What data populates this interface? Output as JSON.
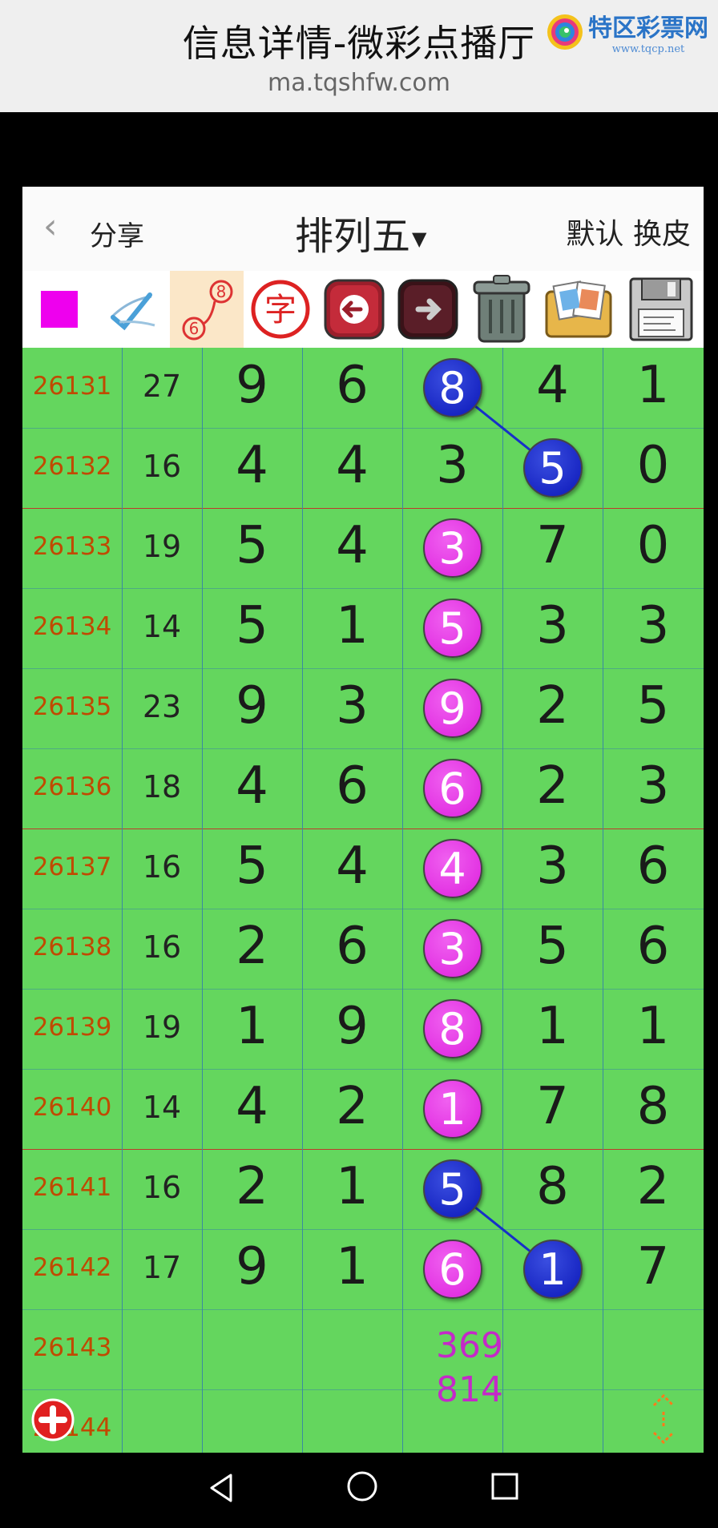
{
  "top": {
    "title": "信息详情-微彩点播厅",
    "url": "ma.tqshfw.com",
    "logo_text": "特区彩票网",
    "logo_sub": "www.tqcp.net"
  },
  "header": {
    "back_icon": "chevron-left-icon",
    "share_label": "分享",
    "title": "排列五",
    "default_label": "默认",
    "skin_label": "换皮"
  },
  "toolbar": {
    "tools": [
      "color-swatch",
      "pen-check-icon",
      "connect-numbers-icon",
      "text-char-icon",
      "undo-arrow-icon",
      "redo-arrow-icon",
      "trash-icon",
      "pictures-icon",
      "floppy-save-icon"
    ],
    "text_char": "字",
    "connect_top": "8",
    "connect_bottom": "6",
    "swatch_color": "#ee00ee"
  },
  "colors": {
    "grid_bg": "#64d65e",
    "period": "#c04a00",
    "blue_ball": "#0b17b8",
    "magenta_ball": "#dd20dd",
    "separator": "#c0392b"
  },
  "rows": [
    {
      "period": "26131",
      "sum": "27",
      "d": [
        "9",
        "6",
        "8",
        "4",
        "1"
      ]
    },
    {
      "period": "26132",
      "sum": "16",
      "d": [
        "4",
        "4",
        "3",
        "5",
        "0"
      ]
    },
    {
      "period": "26133",
      "sum": "19",
      "d": [
        "5",
        "4",
        "3",
        "7",
        "0"
      ]
    },
    {
      "period": "26134",
      "sum": "14",
      "d": [
        "5",
        "1",
        "5",
        "3",
        "3"
      ]
    },
    {
      "period": "26135",
      "sum": "23",
      "d": [
        "9",
        "3",
        "9",
        "2",
        "5"
      ]
    },
    {
      "period": "26136",
      "sum": "18",
      "d": [
        "4",
        "6",
        "6",
        "2",
        "3"
      ]
    },
    {
      "period": "26137",
      "sum": "16",
      "d": [
        "5",
        "4",
        "4",
        "3",
        "6"
      ]
    },
    {
      "period": "26138",
      "sum": "16",
      "d": [
        "2",
        "6",
        "3",
        "5",
        "6"
      ]
    },
    {
      "period": "26139",
      "sum": "19",
      "d": [
        "1",
        "9",
        "8",
        "1",
        "1"
      ]
    },
    {
      "period": "26140",
      "sum": "14",
      "d": [
        "4",
        "2",
        "1",
        "7",
        "8"
      ]
    },
    {
      "period": "26141",
      "sum": "16",
      "d": [
        "2",
        "1",
        "5",
        "8",
        "2"
      ]
    },
    {
      "period": "26142",
      "sum": "17",
      "d": [
        "9",
        "1",
        "6",
        "1",
        "7"
      ]
    },
    {
      "period": "26143",
      "sum": "",
      "d": [
        "",
        "",
        "",
        "",
        ""
      ]
    },
    {
      "period": "26144",
      "sum": "",
      "d": [
        "",
        "",
        "",
        "",
        ""
      ]
    }
  ],
  "balls": [
    {
      "row": 0,
      "col": 2,
      "color": "blue"
    },
    {
      "row": 1,
      "col": 3,
      "color": "blue"
    },
    {
      "row": 2,
      "col": 2,
      "color": "magenta"
    },
    {
      "row": 3,
      "col": 2,
      "color": "magenta"
    },
    {
      "row": 4,
      "col": 2,
      "color": "magenta"
    },
    {
      "row": 5,
      "col": 2,
      "color": "magenta"
    },
    {
      "row": 6,
      "col": 2,
      "color": "magenta"
    },
    {
      "row": 7,
      "col": 2,
      "color": "magenta"
    },
    {
      "row": 8,
      "col": 2,
      "color": "magenta"
    },
    {
      "row": 9,
      "col": 2,
      "color": "magenta"
    },
    {
      "row": 10,
      "col": 2,
      "color": "blue"
    },
    {
      "row": 11,
      "col": 2,
      "color": "magenta"
    },
    {
      "row": 11,
      "col": 3,
      "color": "blue"
    }
  ],
  "connections": [
    {
      "from": [
        0,
        2
      ],
      "to": [
        1,
        3
      ]
    },
    {
      "from": [
        10,
        2
      ],
      "to": [
        11,
        3
      ]
    }
  ],
  "group_separators_after_rows": [
    1,
    5,
    9
  ],
  "prediction": {
    "line1": "369",
    "line2": "814"
  },
  "floating": {
    "add_icon": "plus-circle-icon",
    "scroll_icon": "scroll-updown-icon"
  },
  "navbar": {
    "back": "nav-back-icon",
    "home": "nav-home-icon",
    "recent": "nav-recents-icon"
  }
}
